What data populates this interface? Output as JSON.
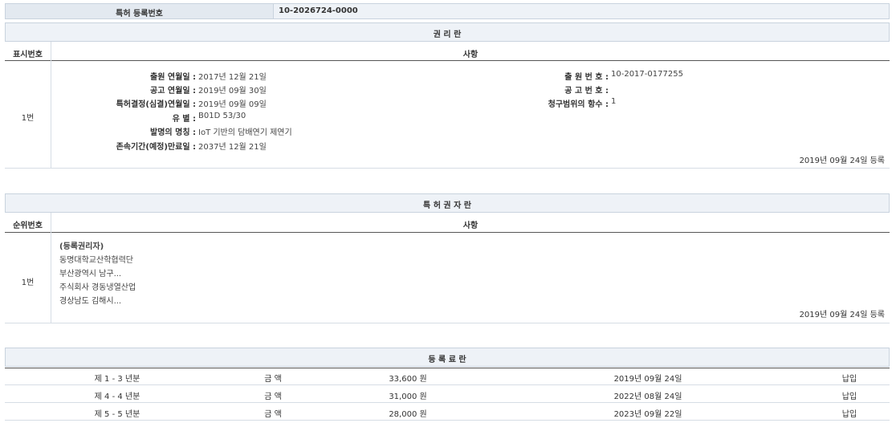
{
  "top_bar": {
    "label": "특허 등록번호",
    "value": "10-2026724-0000"
  },
  "rights": {
    "title": "권 리 란",
    "col_no": "표시번호",
    "col_item": "사항",
    "row_no": "1번",
    "fields": [
      {
        "label": "출원 연월일 :",
        "value": "2017년 12월 21일"
      },
      {
        "label": "공고 연월일 :",
        "value": "2019년 09월 30일"
      },
      {
        "label": "특허결정(심결)연월일 :",
        "value": "2019년 09월 09일"
      },
      {
        "label": "유 별 :",
        "value": "B01D 53/30"
      },
      {
        "label": "발명의 명칭 :",
        "value": "IoT 기반의 담배연기 제연기"
      },
      {
        "label": "존속기간(예정)만료일 :",
        "value": "2037년 12월 21일"
      }
    ],
    "right_fields": [
      {
        "label": "출 원 번 호 :",
        "value": "10-2017-0177255"
      },
      {
        "label": "공 고 번 호 :",
        "value": ""
      },
      {
        "label": "청구범위의 항수 :",
        "value": "1"
      }
    ],
    "reg_date": "2019년 09월 24일 등록"
  },
  "holders": {
    "title": "특 허 권 자 란",
    "col_no": "순위번호",
    "col_item": "사항",
    "row_no": "1번",
    "lines": [
      "(등록권리자)",
      "동명대학교산학협력단",
      "부산광역시 남구...",
      "주식회사 경동냉열산업",
      "경상남도 김해시..."
    ],
    "reg_date": "2019년 09월 24일 등록"
  },
  "fees": {
    "title": "등 록 료 란",
    "rows": [
      {
        "term": "제 1 - 3 년분",
        "amount_label": "금 액",
        "amount": "33,600 원",
        "date": "2019년 09월 24일",
        "status": "납입"
      },
      {
        "term": "제 4 - 4 년분",
        "amount_label": "금 액",
        "amount": "31,000 원",
        "date": "2022년 08월 24일",
        "status": "납입"
      },
      {
        "term": "제 5 - 5 년분",
        "amount_label": "금 액",
        "amount": "28,000 원",
        "date": "2023년 09월 22일",
        "status": "납입"
      }
    ]
  }
}
